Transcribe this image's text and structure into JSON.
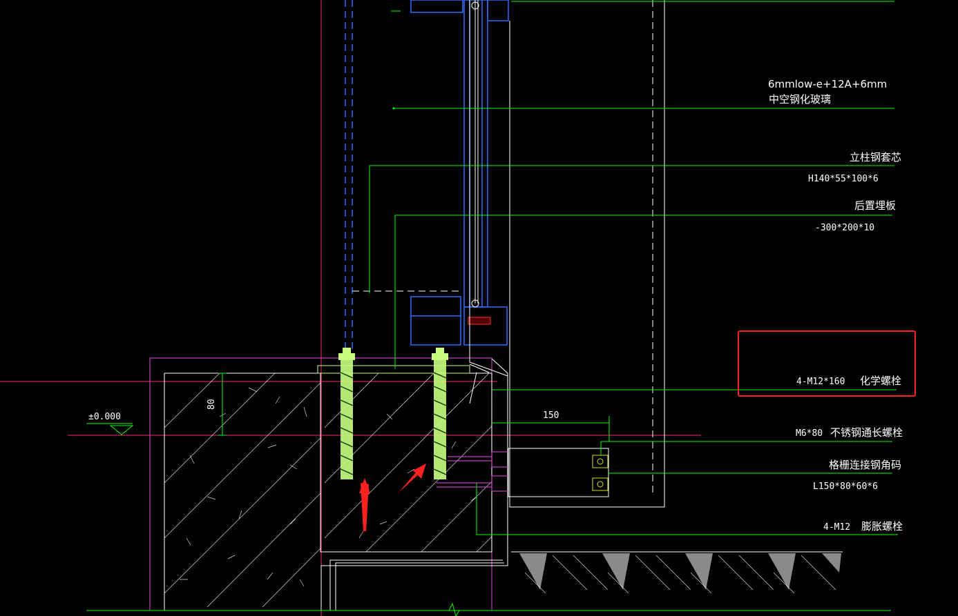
{
  "drawing": {
    "background": "#000000",
    "colors": {
      "leader": "#00ff00",
      "frame": "#2a6cff",
      "outline": "#c040c0",
      "grid_line": "#ff2a6d",
      "anchor": "#c8ff80",
      "highlight": "#ff2020",
      "text": "#ffffff"
    },
    "labels": {
      "glass_spec": "6mmlow-e+12A+6mm",
      "glass_name": "中空钢化玻璃",
      "column_core": "立柱钢套芯",
      "column_spec": "H140*55*100*6",
      "embed_plate": "后置埋板",
      "embed_spec": "-300*200*10",
      "chem_bolt_spec": "4-M12*160",
      "chem_bolt_name": "化学螺栓",
      "ss_bolt_spec": "M6*80",
      "ss_bolt_name": "不锈钢通长螺栓",
      "grille_angle": "格栅连接钢角码",
      "angle_spec": "L150*80*60*6",
      "exp_bolt_spec": "4-M12",
      "exp_bolt_name": "膨胀螺栓"
    },
    "dimensions": {
      "elevation": "±0.000",
      "depth": "80",
      "offset": "150"
    }
  }
}
